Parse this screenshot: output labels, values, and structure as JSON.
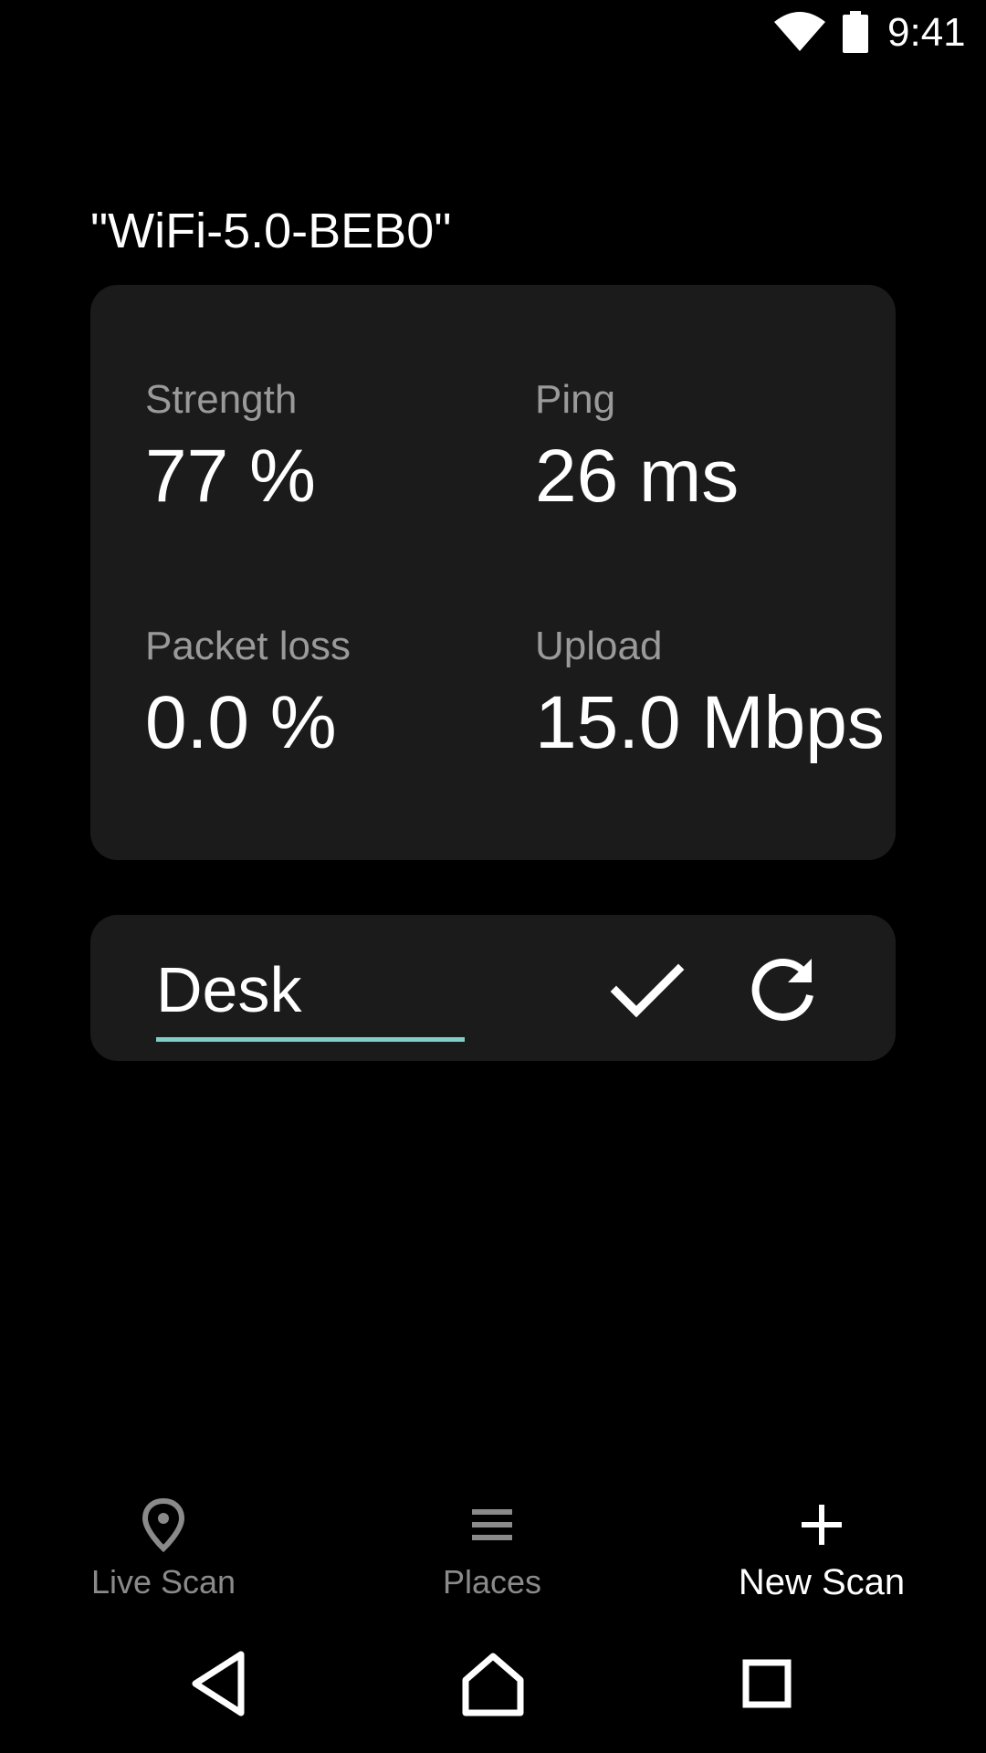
{
  "status_bar": {
    "time": "9:41",
    "icons": [
      "wifi-icon",
      "battery-icon"
    ]
  },
  "network": {
    "name": "\"WiFi-5.0-BEB0\""
  },
  "stats": {
    "strength": {
      "label": "Strength",
      "value": "77 %"
    },
    "ping": {
      "label": "Ping",
      "value": "26 ms"
    },
    "packet_loss": {
      "label": "Packet loss",
      "value": "0.0 %"
    },
    "upload": {
      "label": "Upload",
      "value": "15.0 Mbps"
    }
  },
  "place": {
    "value": "Desk",
    "confirm_icon": "check-icon",
    "refresh_icon": "refresh-icon"
  },
  "bottom_nav": {
    "items": [
      {
        "label": "Live Scan",
        "icon": "location-pin-icon",
        "active": false
      },
      {
        "label": "Places",
        "icon": "list-icon",
        "active": false
      },
      {
        "label": "New Scan",
        "icon": "plus-icon",
        "active": true
      }
    ]
  },
  "system_nav": {
    "icons": [
      "back-icon",
      "home-icon",
      "recents-icon"
    ]
  },
  "colors": {
    "background": "#000000",
    "card": "#1b1b1b",
    "label": "#9a9a9a",
    "accent": "#7fcfc9",
    "text": "#ffffff"
  }
}
